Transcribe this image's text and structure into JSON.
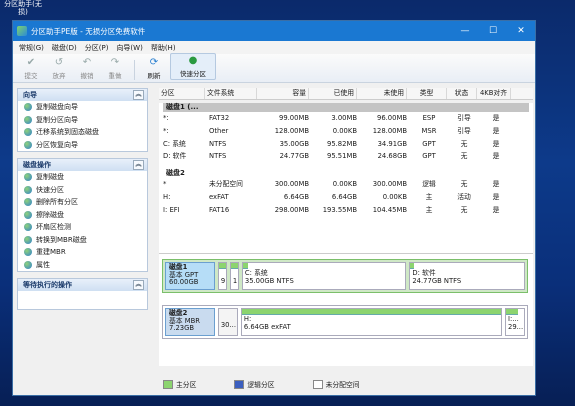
{
  "desktop": {
    "icon_label_1": "分区助手(无",
    "icon_label_2": "损)"
  },
  "window": {
    "title": "分区助手PE版 - 无损分区免费软件",
    "min": "—",
    "max": "☐",
    "close": "✕"
  },
  "menu": [
    "常规(G)",
    "磁盘(D)",
    "分区(P)",
    "向导(W)",
    "帮助(H)"
  ],
  "toolbar": {
    "submit": "提交",
    "discard": "放弃",
    "undo": "撤销",
    "redo": "重做",
    "refresh": "刷新",
    "quick_partition": "快速分区"
  },
  "wizard": {
    "title": "向导",
    "items": [
      "复制磁盘向导",
      "复制分区向导",
      "迁移系统到固态磁盘",
      "分区恢复向导"
    ]
  },
  "disk_ops": {
    "title": "磁盘操作",
    "items": [
      "复制磁盘",
      "快速分区",
      "删除所有分区",
      "擦除磁盘",
      "坏扇区检测",
      "转换到MBR磁盘",
      "重建MBR",
      "属性"
    ]
  },
  "pending": {
    "title": "等待执行的操作"
  },
  "columns": [
    "分区",
    "文件系统",
    "容量",
    "已使用",
    "未使用",
    "类型",
    "状态",
    "4KB对齐"
  ],
  "disk1": {
    "header": "磁盘1 (...",
    "rows": [
      [
        "*:",
        "FAT32",
        "99.00MB",
        "3.00MB",
        "96.00MB",
        "ESP",
        "引导",
        "是"
      ],
      [
        "*:",
        "Other",
        "128.00MB",
        "0.00KB",
        "128.00MB",
        "MSR",
        "引导",
        "是"
      ],
      [
        "C: 系统",
        "NTFS",
        "35.00GB",
        "95.82MB",
        "34.91GB",
        "GPT",
        "无",
        "是"
      ],
      [
        "D: 软件",
        "NTFS",
        "24.77GB",
        "95.51MB",
        "24.68GB",
        "GPT",
        "无",
        "是"
      ]
    ]
  },
  "disk2": {
    "header": "磁盘2",
    "rows": [
      [
        "*",
        "未分配空间",
        "300.00MB",
        "0.00KB",
        "300.00MB",
        "逻辑",
        "无",
        "是"
      ],
      [
        "H:",
        "exFAT",
        "6.64GB",
        "6.64GB",
        "0.00KB",
        "主",
        "活动",
        "是"
      ],
      [
        "I: EFI",
        "FAT16",
        "298.00MB",
        "193.55MB",
        "104.45MB",
        "主",
        "无",
        "是"
      ]
    ]
  },
  "map": {
    "disk1": {
      "name": "磁盘1",
      "type": "基本 GPT",
      "size": "60.00GB",
      "parts": [
        {
          "top": "",
          "bottom": "9"
        },
        {
          "top": "",
          "bottom": "1"
        },
        {
          "top": "C: 系统",
          "bottom": "35.00GB NTFS"
        },
        {
          "top": "D: 软件",
          "bottom": "24.77GB NTFS"
        }
      ]
    },
    "disk2": {
      "name": "磁盘2",
      "type": "基本 MBR",
      "size": "7.23GB",
      "parts": [
        {
          "top": "",
          "bottom": "30..."
        },
        {
          "top": "H:",
          "bottom": "6.64GB exFAT"
        },
        {
          "top": "I:...",
          "bottom": "29..."
        }
      ]
    }
  },
  "legend": {
    "primary": "主分区",
    "logical": "逻辑分区",
    "unallocated": "未分配空间"
  },
  "colors": {
    "primary": "#8cd46f",
    "logical": "#3b5fbf",
    "unallocated": "#ffffff",
    "titlebar": "#1a78d2"
  }
}
